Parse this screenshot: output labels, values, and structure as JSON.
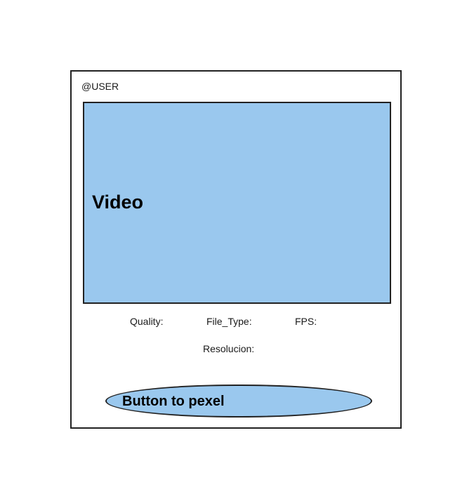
{
  "card": {
    "user_handle": "@USER",
    "video": {
      "label": "Video"
    },
    "meta": {
      "quality_label": "Quality:",
      "file_type_label": "File_Type:",
      "fps_label": "FPS:",
      "resolution_label": "Resolucion:"
    },
    "pexel_button": {
      "label": "Button to pexel"
    }
  },
  "colors": {
    "video_fill": "#9ac8ee",
    "button_fill": "#9ac8ee",
    "border": "#222222"
  }
}
